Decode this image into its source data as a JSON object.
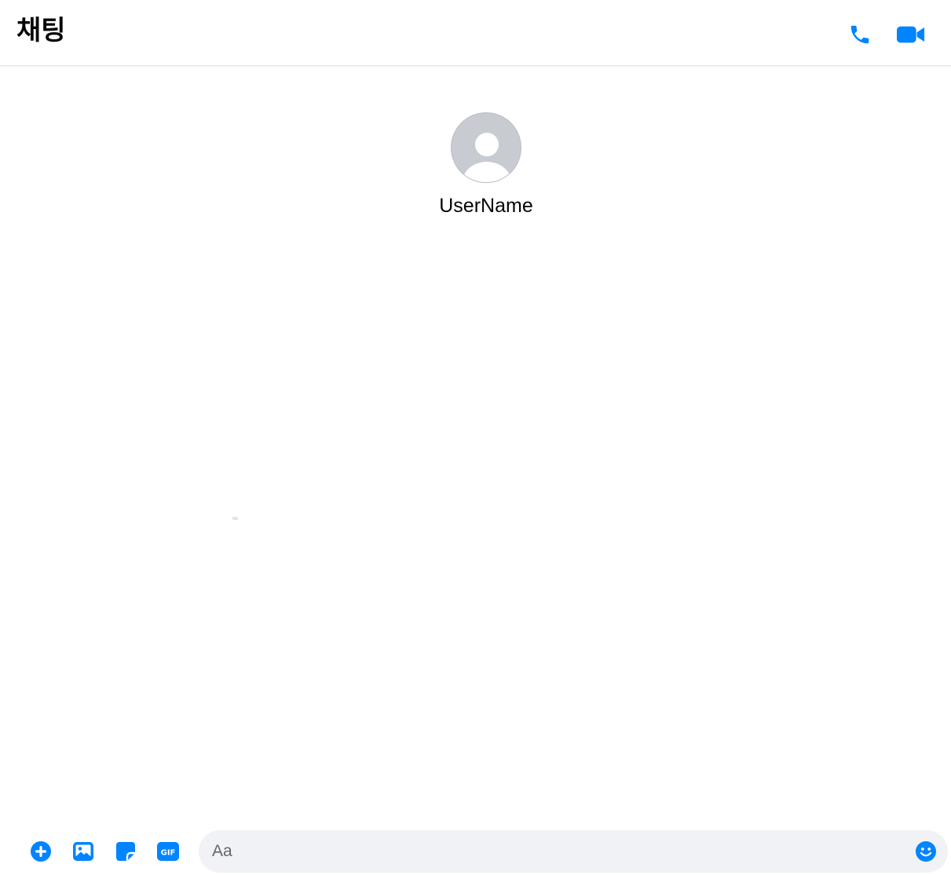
{
  "header": {
    "title": "채팅",
    "phone_icon": "phone-icon",
    "video_icon": "video-camera-icon"
  },
  "profile": {
    "name": "UserName",
    "avatar_icon": "default-avatar-icon"
  },
  "composer": {
    "placeholder": "Aa",
    "value": ""
  },
  "toolbar": {
    "icons": [
      "plus-circle-icon",
      "photo-icon",
      "sticker-icon",
      "gif-icon",
      "emoji-icon"
    ],
    "gif_text": "GIF"
  },
  "colors": {
    "accent": "#0084ff",
    "composer_bg": "#f0f2f5",
    "avatar_bg": "#c8ccd2"
  }
}
